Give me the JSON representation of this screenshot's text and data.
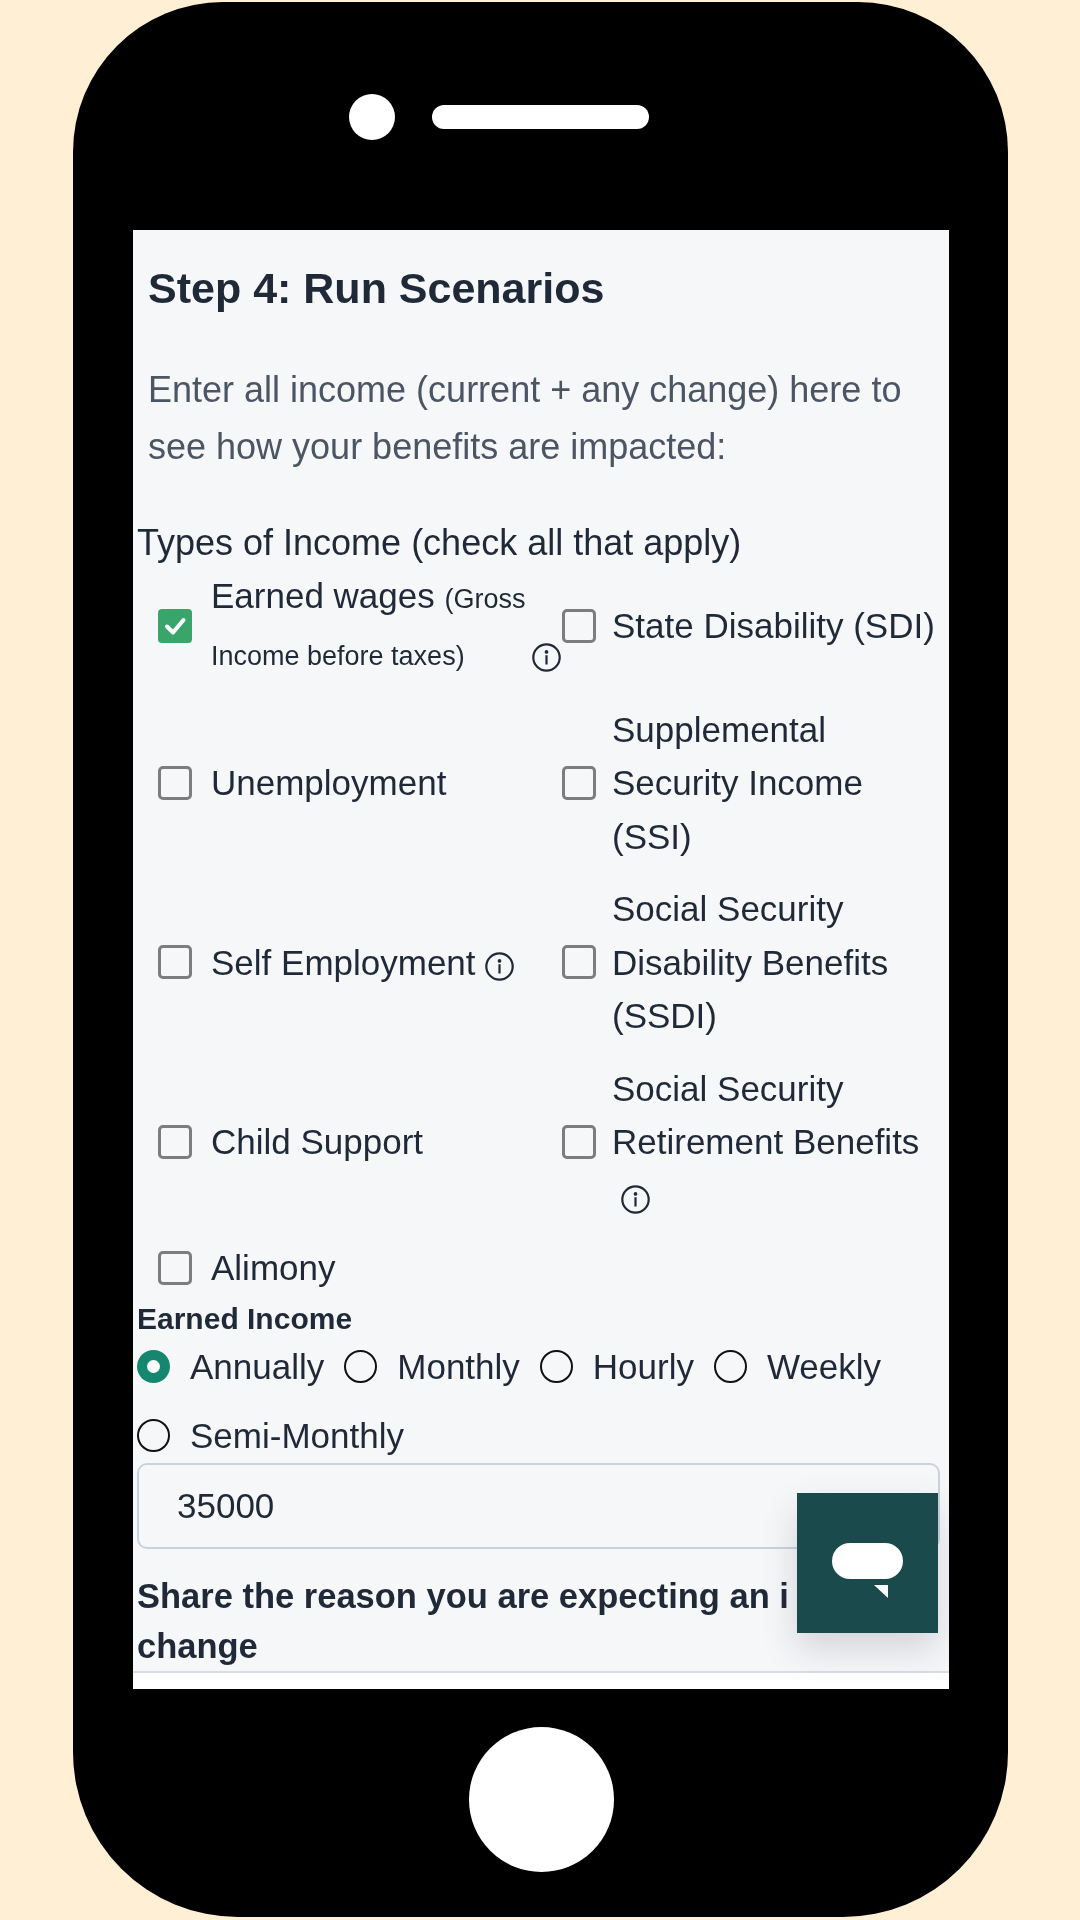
{
  "heading": "Step 4: Run Scenarios",
  "intro": "Enter all income (current + any change) here to see how your benefits are impacted:",
  "income_types": {
    "label": "Types of Income (check all that apply)",
    "options": [
      {
        "label": "Earned wages",
        "note": "(Gross Income before taxes)",
        "info": true,
        "checked": true
      },
      {
        "label": "State Disability (SDI)",
        "info": false,
        "checked": false
      },
      {
        "label": "Unemployment",
        "info": false,
        "checked": false
      },
      {
        "label": "Supplemental Security Income (SSI)",
        "info": false,
        "checked": false
      },
      {
        "label": "Self Employment",
        "info": true,
        "checked": false
      },
      {
        "label": "Social Security Disability Benefits (SSDI)",
        "info": false,
        "checked": false
      },
      {
        "label": "Child Support",
        "info": false,
        "checked": false
      },
      {
        "label": "Social Security Retirement Benefits",
        "info": true,
        "checked": false
      },
      {
        "label": "Alimony",
        "info": false,
        "checked": false
      }
    ]
  },
  "earned_income": {
    "label": "Earned Income",
    "frequencies": [
      {
        "label": "Annually",
        "selected": true
      },
      {
        "label": "Monthly",
        "selected": false
      },
      {
        "label": "Hourly",
        "selected": false
      },
      {
        "label": "Weekly",
        "selected": false
      },
      {
        "label": "Semi-Monthly",
        "selected": false
      }
    ],
    "amount": "35000"
  },
  "reason": {
    "label": "Share the reason you are expecting an i\nchange"
  }
}
